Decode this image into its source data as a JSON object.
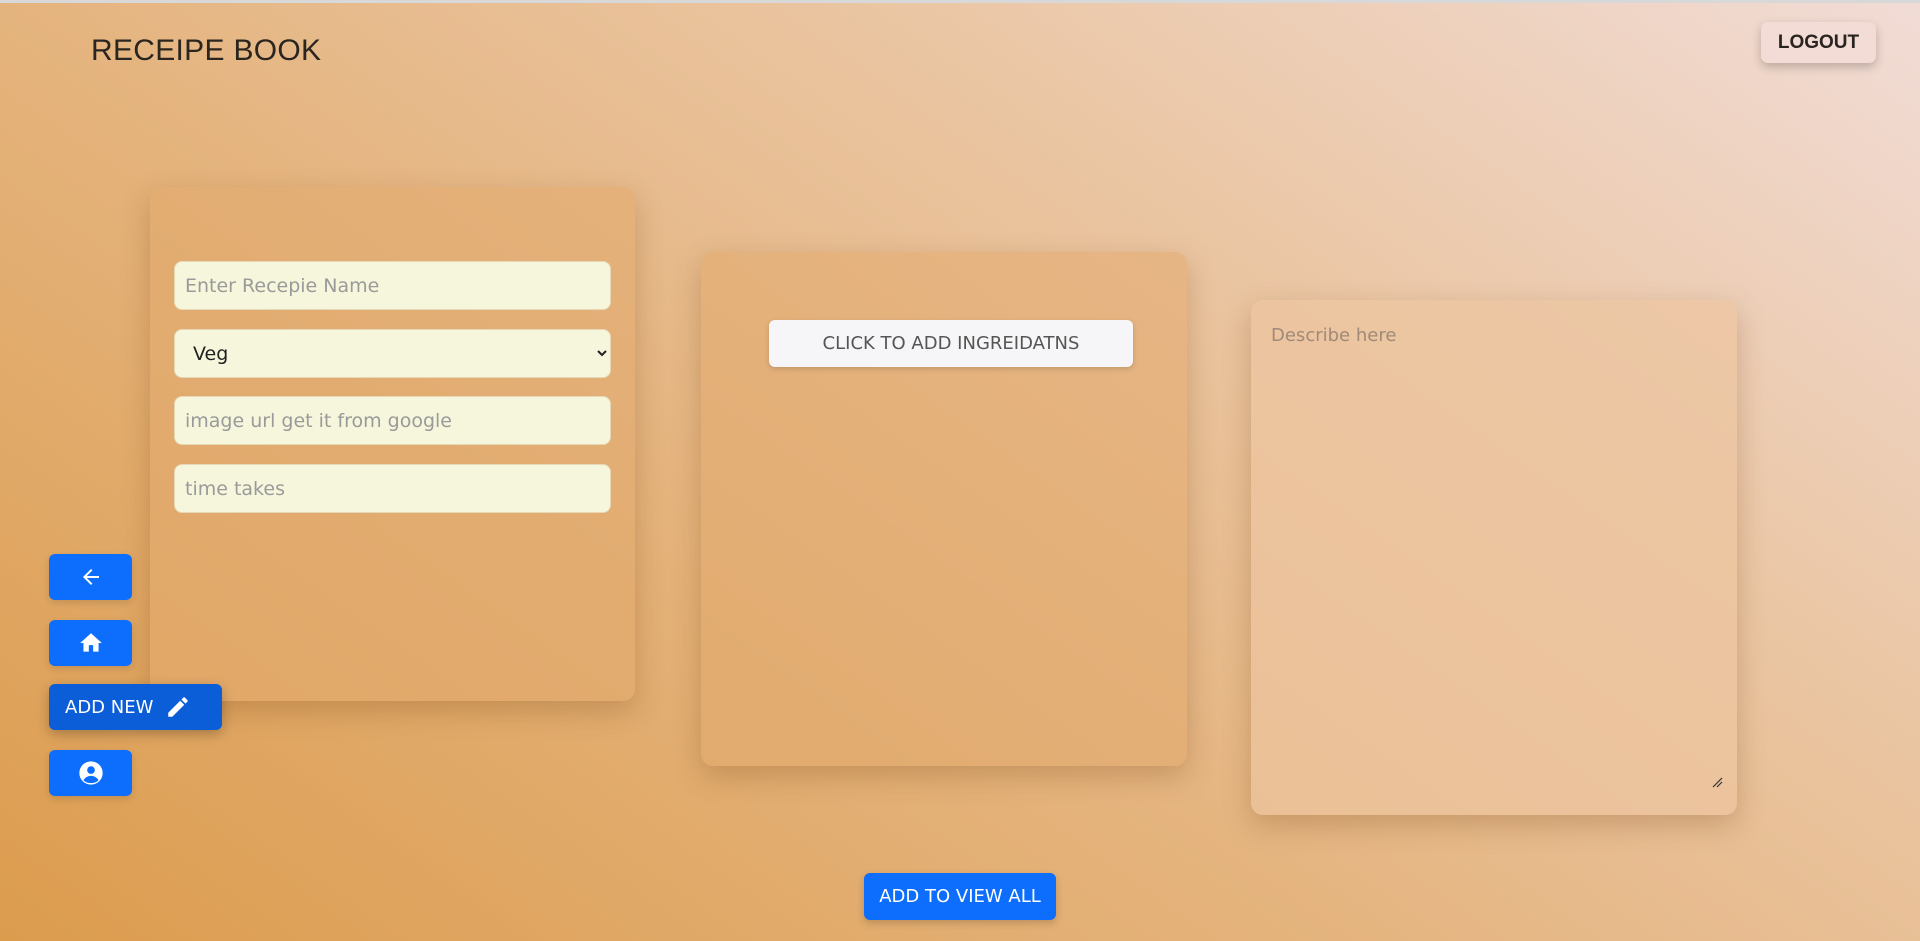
{
  "header": {
    "title": "RECEIPE BOOK",
    "logout_label": "LOGOUT"
  },
  "form": {
    "name_placeholder": "Enter Recepie Name",
    "type_selected": "Veg",
    "image_placeholder": "image url get it from google",
    "time_placeholder": "time takes"
  },
  "ingredients": {
    "button_label": "CLICK TO ADD INGREIDATNS"
  },
  "description": {
    "placeholder": "Describe here"
  },
  "sidebar": {
    "back_icon": "arrow-left-icon",
    "home_icon": "home-icon",
    "add_new_label": "ADD NEW",
    "add_new_icon": "pencil-icon",
    "profile_icon": "user-circle-icon"
  },
  "footer": {
    "submit_label": "ADD TO VIEW ALL"
  },
  "colors": {
    "primary": "#0d6efd",
    "field_bg": "#f6f6dc"
  }
}
